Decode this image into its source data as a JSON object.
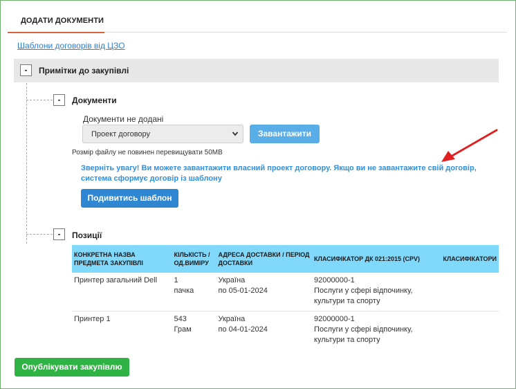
{
  "tab": {
    "label": "ДОДАТИ ДОКУМЕНТИ"
  },
  "templates_link": "Шаблони договорів від ЦЗО",
  "notes_section": {
    "toggle": "-",
    "title": "Примітки до закупівлі"
  },
  "documents_section": {
    "toggle": "-",
    "title": "Документи",
    "status_label": "Документи не додані",
    "select_value": "Проект договору",
    "upload_button": "Завантажити",
    "size_hint": "Розмір файлу не повинен перевищувати 50MB",
    "notice": "Зверніть увагу! Ви можете завантажити власний проект договору. Якщо ви не завантажите свій договір, система сформує договір із шаблону",
    "view_template_button": "Подивитись шаблон"
  },
  "positions_section": {
    "toggle": "-",
    "title": "Позиції",
    "columns": [
      "КОНКРЕТНА НАЗВА ПРЕДМЕТА ЗАКУПІВЛІ",
      "КІЛЬКІСТЬ / ОД.ВИМІРУ",
      "АДРЕСА ДОСТАВКИ / ПЕРІОД ДОСТАВКИ",
      "КЛАСИФІКАТОР ДК 021:2015 (CPV)",
      "КЛАСИФІКАТОРИ"
    ],
    "rows": [
      {
        "name": "Принтер загальний Dell",
        "qty": "1",
        "unit": "пачка",
        "country": "Україна",
        "period": "по 05-01-2024",
        "cpv_code": "92000000-1",
        "cpv_desc": "Послуги у сфері відпочинку, культури та спорту",
        "other": ""
      },
      {
        "name": "Принтер 1",
        "qty": "543",
        "unit": "Грам",
        "country": "Україна",
        "period": "по 04-01-2024",
        "cpv_code": "92000000-1",
        "cpv_desc": "Послуги у сфері відпочинку, культури та спорту",
        "other": ""
      }
    ]
  },
  "publish_button": "Опублікувати закупівлю",
  "colors": {
    "accent_blue": "#2f87d2",
    "light_blue": "#5aaee8",
    "notice_blue": "#2f8fe0",
    "header_cyan": "#80d8fb",
    "green": "#2fb344",
    "tab_underline": "#e0603a",
    "arrow_red": "#e02020"
  },
  "icons": {
    "select_chevron": "chevron-down-icon",
    "annotation_arrow": "red-arrow-icon"
  }
}
